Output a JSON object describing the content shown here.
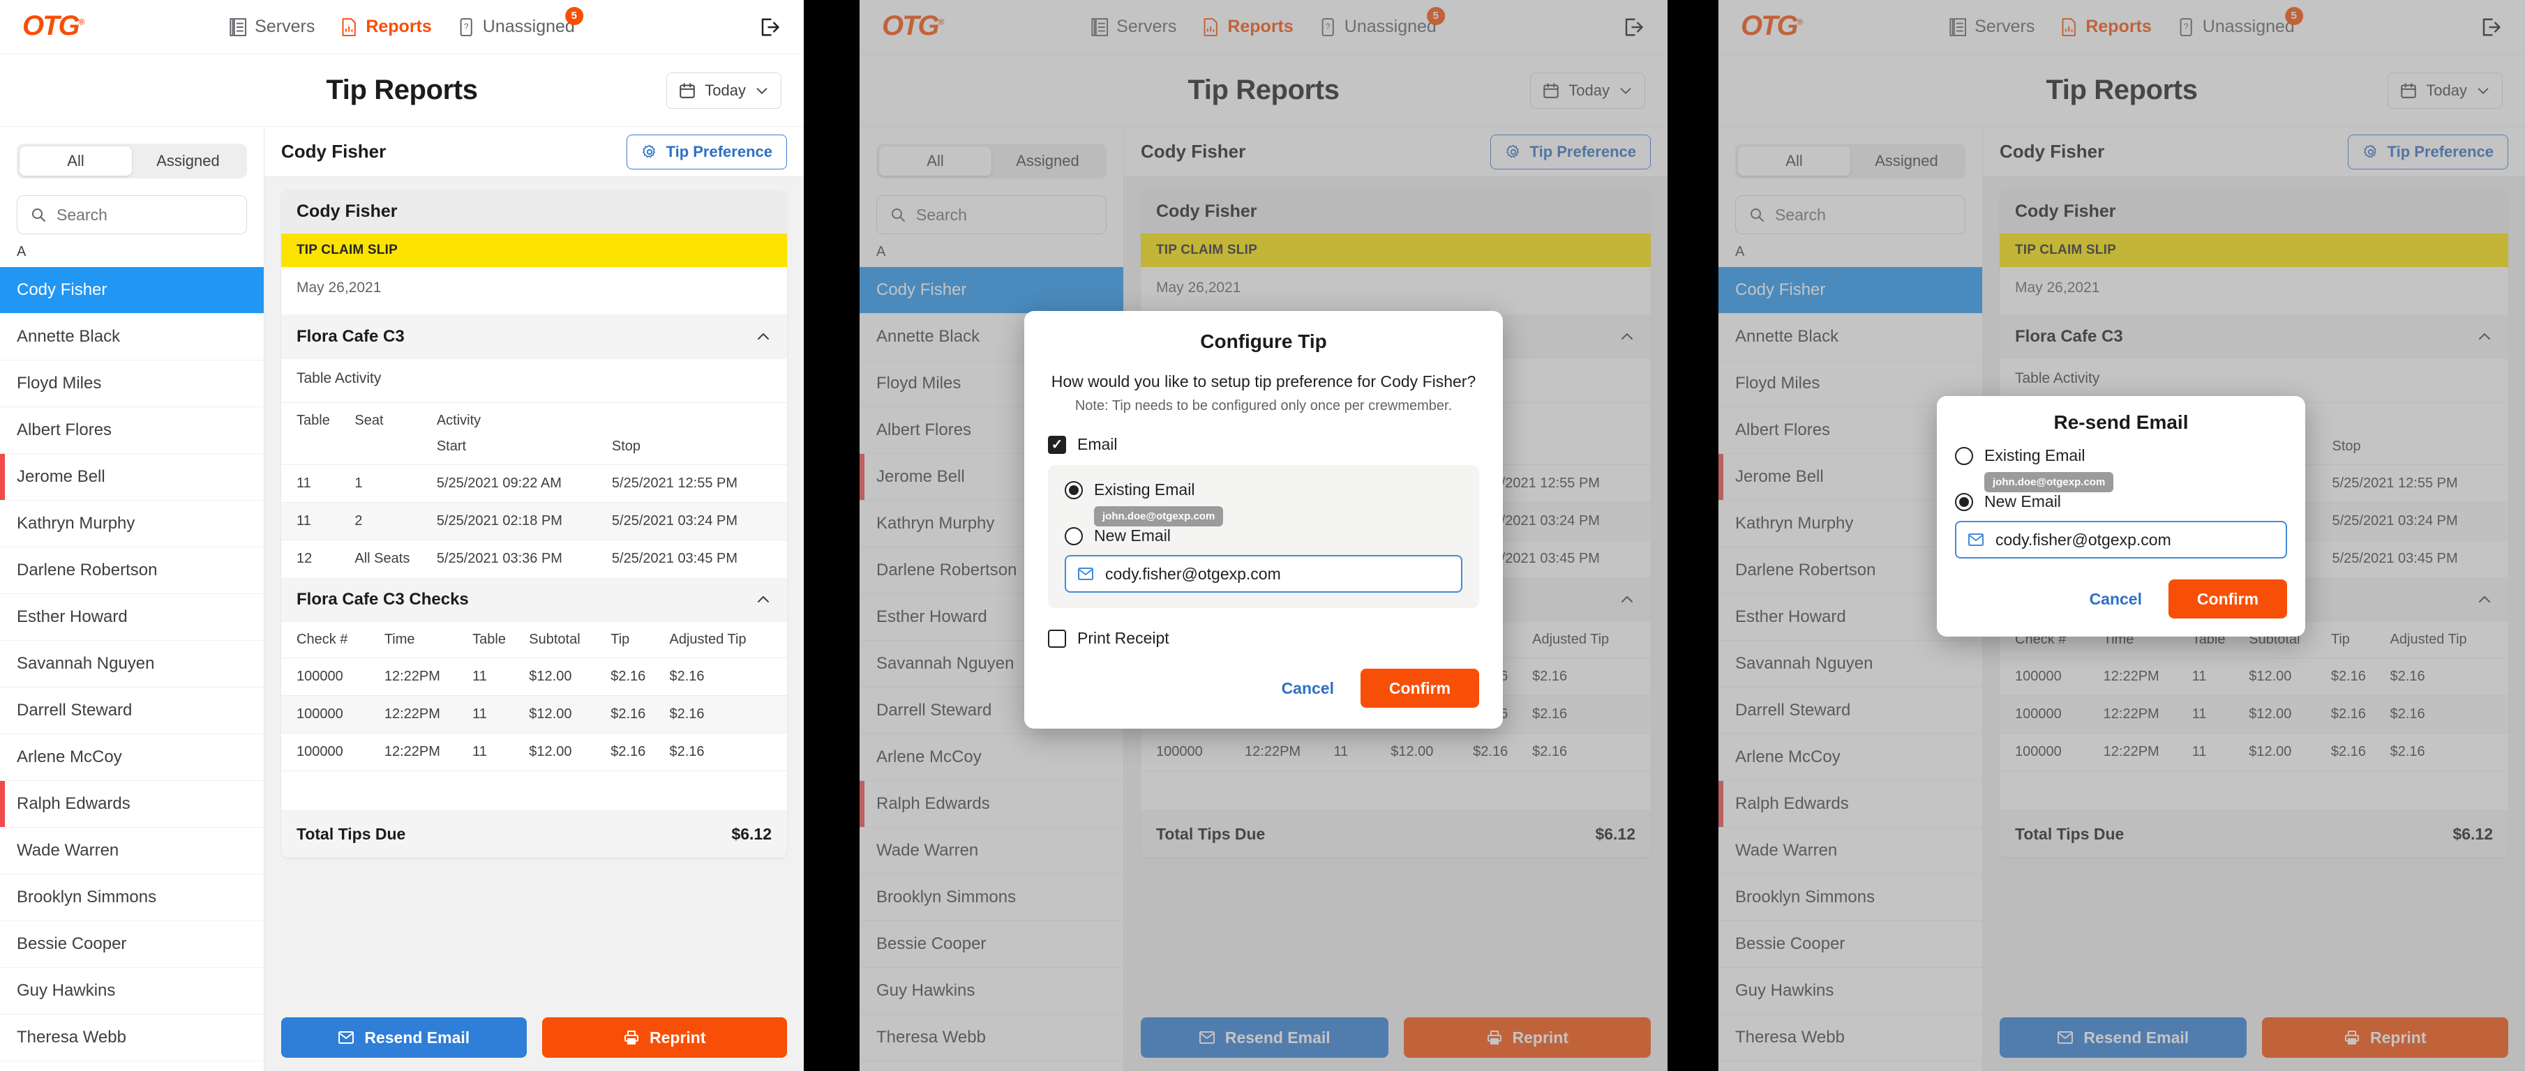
{
  "nav": {
    "logo": "OTG",
    "items": [
      {
        "label": "Servers",
        "icon": "server-icon",
        "active": false
      },
      {
        "label": "Reports",
        "icon": "report-chart-icon",
        "active": true
      },
      {
        "label": "Unassigned",
        "icon": "unassigned-device-icon",
        "active": false,
        "badge": "5"
      }
    ],
    "logout_icon": "logout-icon"
  },
  "header": {
    "title": "Tip Reports",
    "date_filter": {
      "label": "Today",
      "icon": "calendar-icon",
      "chevron": "chevron-down-icon"
    }
  },
  "sidebar": {
    "segments": [
      {
        "label": "All",
        "active": true
      },
      {
        "label": "Assigned",
        "active": false
      }
    ],
    "search": {
      "placeholder": "Search",
      "value": "",
      "icon": "search-icon"
    },
    "alpha_header": "A",
    "names": [
      {
        "label": "Cody Fisher",
        "selected": true,
        "flagged": false
      },
      {
        "label": "Annette Black",
        "selected": false,
        "flagged": false
      },
      {
        "label": "Floyd Miles",
        "selected": false,
        "flagged": false
      },
      {
        "label": "Albert Flores",
        "selected": false,
        "flagged": false
      },
      {
        "label": "Jerome Bell",
        "selected": false,
        "flagged": true
      },
      {
        "label": "Kathryn Murphy",
        "selected": false,
        "flagged": false
      },
      {
        "label": "Darlene Robertson",
        "selected": false,
        "flagged": false
      },
      {
        "label": "Esther Howard",
        "selected": false,
        "flagged": false
      },
      {
        "label": "Savannah Nguyen",
        "selected": false,
        "flagged": false
      },
      {
        "label": "Darrell Steward",
        "selected": false,
        "flagged": false
      },
      {
        "label": "Arlene McCoy",
        "selected": false,
        "flagged": false
      },
      {
        "label": "Ralph Edwards",
        "selected": false,
        "flagged": true
      },
      {
        "label": "Wade Warren",
        "selected": false,
        "flagged": false
      },
      {
        "label": "Brooklyn Simmons",
        "selected": false,
        "flagged": false
      },
      {
        "label": "Bessie Cooper",
        "selected": false,
        "flagged": false
      },
      {
        "label": "Guy Hawkins",
        "selected": false,
        "flagged": false
      },
      {
        "label": "Theresa Webb",
        "selected": false,
        "flagged": false
      }
    ]
  },
  "detail": {
    "crew_name": "Cody Fisher",
    "tip_preference_button": {
      "label": "Tip Preference",
      "icon": "gear-icon"
    },
    "card_title": "Cody Fisher",
    "slip_banner": "TIP CLAIM SLIP",
    "slip_date": "May 26,2021",
    "activity_section": {
      "title": "Flora Cafe C3",
      "collapse_icon": "chevron-up-icon",
      "sub_label": "Table Activity",
      "columns": [
        "Table",
        "Seat",
        "Activity",
        ""
      ],
      "sub_columns": [
        "Start",
        "Stop"
      ],
      "rows": [
        {
          "table": "11",
          "seat": "1",
          "start": "5/25/2021  09:22 AM",
          "stop": "5/25/2021  12:55 PM"
        },
        {
          "table": "11",
          "seat": "2",
          "start": "5/25/2021  02:18 PM",
          "stop": "5/25/2021  03:24 PM"
        },
        {
          "table": "12",
          "seat": "All Seats",
          "start": "5/25/2021  03:36 PM",
          "stop": "5/25/2021  03:45 PM"
        }
      ]
    },
    "checks_section": {
      "title": "Flora Cafe C3 Checks",
      "collapse_icon": "chevron-up-icon",
      "columns": [
        "Check #",
        "Time",
        "Table",
        "Subtotal",
        "Tip",
        "Adjusted Tip"
      ],
      "rows": [
        {
          "check": "100000",
          "time": "12:22PM",
          "table": "11",
          "subtotal": "$12.00",
          "tip": "$2.16",
          "adjusted_tip": "$2.16"
        },
        {
          "check": "100000",
          "time": "12:22PM",
          "table": "11",
          "subtotal": "$12.00",
          "tip": "$2.16",
          "adjusted_tip": "$2.16"
        },
        {
          "check": "100000",
          "time": "12:22PM",
          "table": "11",
          "subtotal": "$12.00",
          "tip": "$2.16",
          "adjusted_tip": "$2.16"
        }
      ],
      "total_label": "Total Tips Due",
      "total_value": "$6.12"
    },
    "actions": [
      {
        "label": "Resend Email",
        "icon": "envelope-icon",
        "style": "blue"
      },
      {
        "label": "Reprint",
        "icon": "printer-icon",
        "style": "orange"
      }
    ]
  },
  "configure_tip_modal": {
    "title": "Configure Tip",
    "question": "How would you like to setup tip preference for Cody Fisher?",
    "note": "Note: Tip needs to be configured only once per crewmember.",
    "email_checkbox": {
      "label": "Email",
      "checked": true
    },
    "options": [
      {
        "label": "Existing Email",
        "selected": true,
        "pill": "john.doe@otgexp.com"
      },
      {
        "label": "New Email",
        "selected": false
      }
    ],
    "email_field": {
      "value": "cody.fisher@otgexp.com",
      "icon": "envelope-icon"
    },
    "print_checkbox": {
      "label": "Print Receipt",
      "checked": false
    },
    "cancel_label": "Cancel",
    "confirm_label": "Confirm"
  },
  "resend_email_modal": {
    "title": "Re-send Email",
    "options": [
      {
        "label": "Existing Email",
        "selected": false,
        "pill": "john.doe@otgexp.com"
      },
      {
        "label": "New Email",
        "selected": true
      }
    ],
    "email_field": {
      "value": "cody.fisher@otgexp.com",
      "icon": "envelope-icon"
    },
    "cancel_label": "Cancel",
    "confirm_label": "Confirm"
  },
  "colors": {
    "brand_orange": "#F74F07",
    "accent_blue": "#2196f3",
    "action_blue": "#2f7ed8",
    "slip_yellow": "#FCE300",
    "flag_red": "#f04b4b"
  }
}
